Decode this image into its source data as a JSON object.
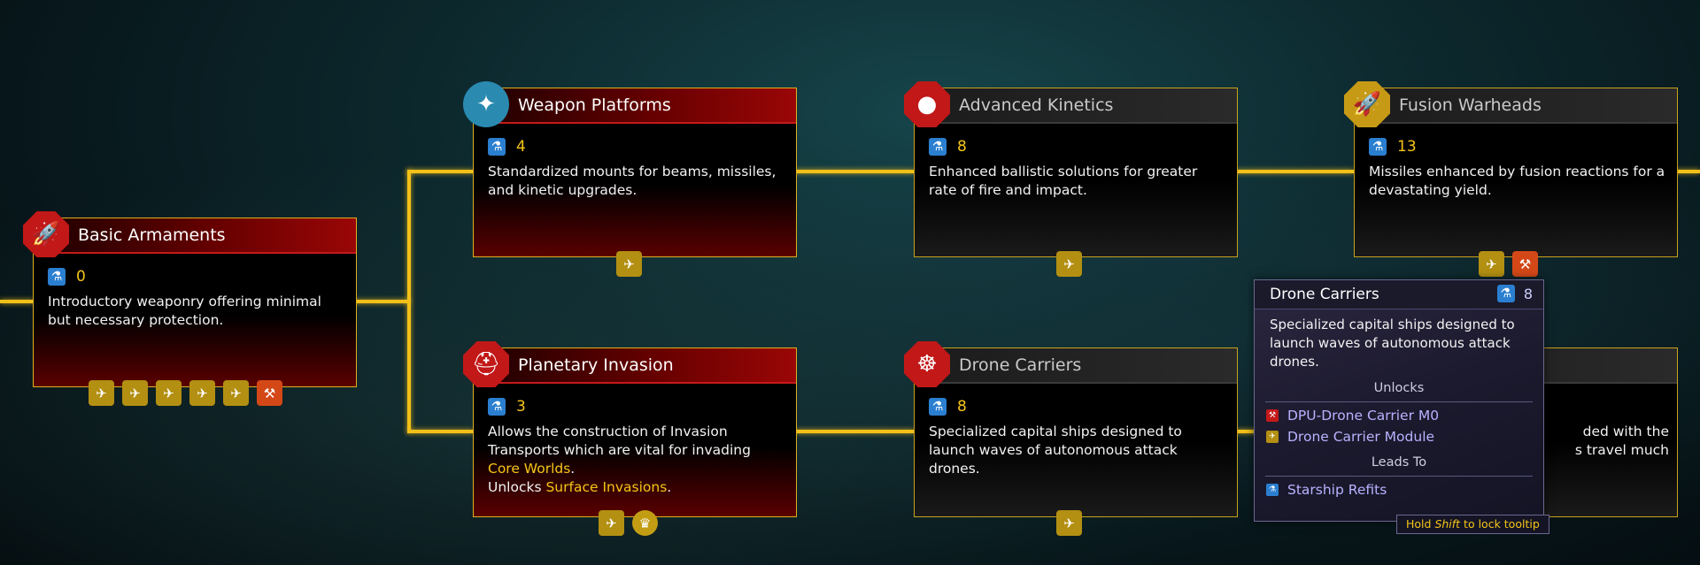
{
  "colors": {
    "connector": "#f2c018",
    "accent_gold": "#f5c518",
    "red_header": "#9a0606",
    "flask_blue": "#2b7fd0",
    "link_purple": "#b9b2ff"
  },
  "cards": {
    "basic_armaments": {
      "title": "Basic Armaments",
      "cost": "0",
      "icon": "rocket-icon",
      "desc": "Introductory weaponry offering minimal but necessary protection."
    },
    "weapon_platforms": {
      "title": "Weapon Platforms",
      "cost": "4",
      "icon": "mount-icon",
      "desc": "Standardized mounts for beams, missiles, and kinetic upgrades."
    },
    "advanced_kinetics": {
      "title": "Advanced Kinetics",
      "cost": "8",
      "icon": "projectile-icon",
      "desc": "Enhanced ballistic solutions for greater rate of fire and impact."
    },
    "fusion_warheads": {
      "title": "Fusion Warheads",
      "cost": "13",
      "icon": "warhead-icon",
      "desc": "Missiles enhanced by fusion reactions for a devastating yield."
    },
    "planetary_invasion": {
      "title": "Planetary Invasion",
      "cost": "3",
      "icon": "helmet-icon",
      "desc_main": "Allows the construction of Invasion Transports which are vital for invading ",
      "desc_link1": "Core Worlds",
      "desc_dot": ".",
      "desc_unlocks": "Unlocks ",
      "desc_link2": "Surface Invasions",
      "desc_end": "."
    },
    "drone_carriers": {
      "title": "Drone Carriers",
      "cost": "8",
      "icon": "drone-icon",
      "desc": "Specialized capital ships designed to launch waves of autonomous attack drones."
    },
    "hidden_card": {
      "desc_line1": "ded with the",
      "desc_line2": "s travel much"
    }
  },
  "tooltip": {
    "title": "Drone Carriers",
    "cost": "8",
    "desc": "Specialized capital ships designed to launch waves of autonomous attack drones.",
    "unlocks_label": "Unlocks",
    "unlocks": [
      "DPU-Drone Carrier M0",
      "Drone Carrier Module"
    ],
    "leads_to_label": "Leads To",
    "leads_to": [
      "Starship Refits"
    ],
    "hint_pre": "Hold ",
    "hint_key": "Shift",
    "hint_post": " to lock tooltip"
  }
}
